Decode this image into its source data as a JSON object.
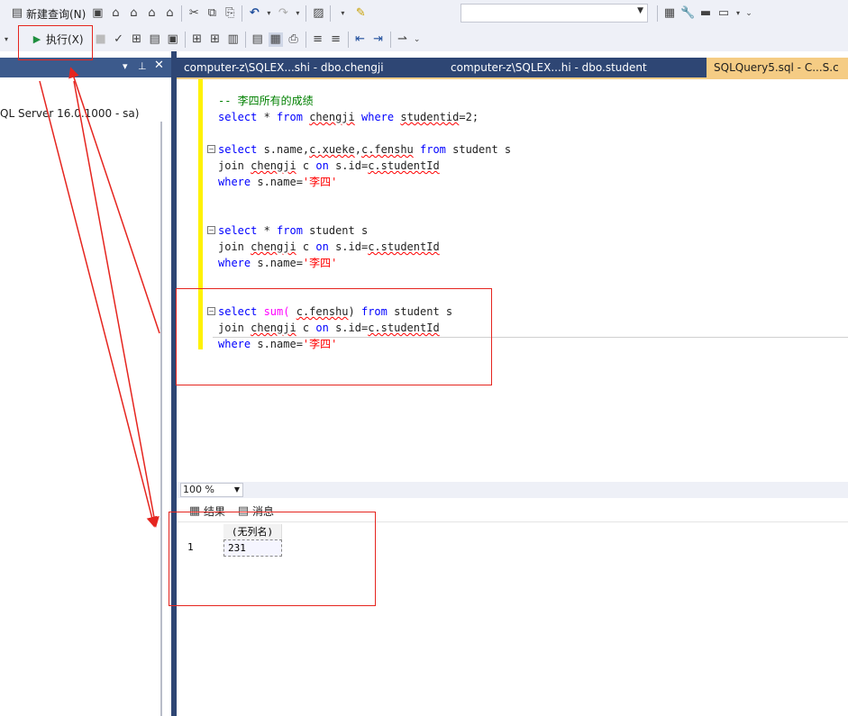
{
  "toolbar1": {
    "new_query_label": "新建查询(N)",
    "combo_value": ""
  },
  "toolbar2": {
    "execute_label": "执行(X)"
  },
  "object_explorer": {
    "server_node_label": "QL Server 16.0.1000 - sa)"
  },
  "tabs": [
    {
      "label": "computer-z\\SQLEX...shi - dbo.chengji"
    },
    {
      "label": "computer-z\\SQLEX...hi - dbo.student"
    },
    {
      "label": "SQLQuery5.sql - C...S.c"
    }
  ],
  "editor": {
    "comment": "-- 李四所有的成绩",
    "q0": {
      "select": "select",
      "star": " * ",
      "from": "from",
      "table": "chengji",
      "where": "where",
      "cond": "studentid",
      "rest": "=2;"
    },
    "q1": {
      "l1_kw": "select",
      "l1_cols_a": " s.name,",
      "l1_col_b": "c.xueke",
      "l1_comma": ",",
      "l1_col_c": "c.fenshu",
      "l1_from": "from",
      "l1_tail": " student s",
      "l2_join": "join ",
      "l2_tbl": "chengji",
      "l2_mid": " c ",
      "l2_on": "on",
      "l2_cond": " s.id=",
      "l2_ref": "c.studentId",
      "l3_where": "where",
      "l3_cond": " s.name=",
      "l3_str": "'李四'"
    },
    "q2": {
      "l1_kw": "select",
      "l1_star": " * ",
      "l1_from": "from",
      "l1_tail": " student s",
      "l2_join": "join ",
      "l2_tbl": "chengji",
      "l2_mid": " c ",
      "l2_on": "on",
      "l2_cond": " s.id=",
      "l2_ref": "c.studentId",
      "l3_where": "where",
      "l3_cond": " s.name=",
      "l3_str": "'李四'"
    },
    "q3": {
      "l1_kw": "select",
      "l1_fn": " sum(",
      "l1_arg": "c.fenshu",
      "l1_close": ")",
      "l1_from": "from",
      "l1_tail": " student s",
      "l2_join": "join ",
      "l2_tbl": "chengji",
      "l2_mid": " c ",
      "l2_on": "on",
      "l2_cond": " s.id=",
      "l2_ref": "c.studentId",
      "l3_where": "where",
      "l3_cond": " s.name=",
      "l3_str": "'李四'"
    }
  },
  "zoom": {
    "value": "100 %"
  },
  "results": {
    "tab_results": "结果",
    "tab_messages": "消息",
    "column_header": "(无列名)",
    "row_number": "1",
    "cell_value": "231"
  },
  "colors": {
    "annotation": "#e5251f",
    "keyword": "#0000ff",
    "comment": "#008000",
    "string": "#ff0000",
    "function": "#ff00ff",
    "tab_active": "#f5cc84",
    "tabstrip": "#2e4674"
  },
  "icons": [
    "new-file-icon",
    "mdx-query-icon",
    "dmx-query-icon",
    "xmla-query-icon",
    "dax-query-icon",
    "cut-icon",
    "copy-icon",
    "paste-icon",
    "undo-icon",
    "redo-icon",
    "activity-monitor-icon",
    "solution-icon",
    "properties-icon",
    "wrench-icon",
    "toolbox-icon",
    "window-icon",
    "play-icon",
    "stop-icon",
    "checkmark-icon",
    "results-grid-icon",
    "messages-icon"
  ]
}
